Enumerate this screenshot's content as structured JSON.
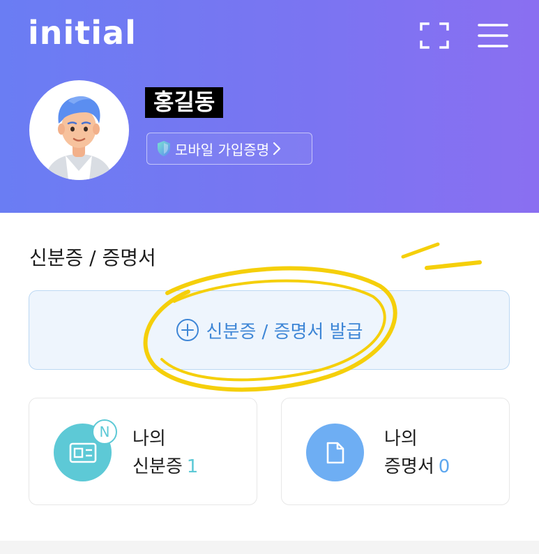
{
  "header": {
    "logo": "initial",
    "scan_icon": "scan-frame-icon",
    "menu_icon": "hamburger-menu-icon",
    "gradient_colors": [
      "#6a7df3",
      "#8a6ff1"
    ]
  },
  "profile": {
    "name": "홍길동",
    "cert_button_label": "모바일 가입증명",
    "cert_icon": "shield-icon",
    "chevron_icon": "chevron-right-icon"
  },
  "section": {
    "title": "신분증 / 증명서",
    "issue_button_label": "신분증 / 증명서 발급",
    "issue_icon": "plus-circle-icon"
  },
  "cards": {
    "id": {
      "line1": "나의",
      "line2": "신분증",
      "count": "1",
      "badge": "N",
      "icon": "id-card-icon",
      "color": "#5dc9d6"
    },
    "cert": {
      "line1": "나의",
      "line2": "증명서",
      "count": "0",
      "icon": "document-icon",
      "color": "#6eaef3"
    }
  }
}
